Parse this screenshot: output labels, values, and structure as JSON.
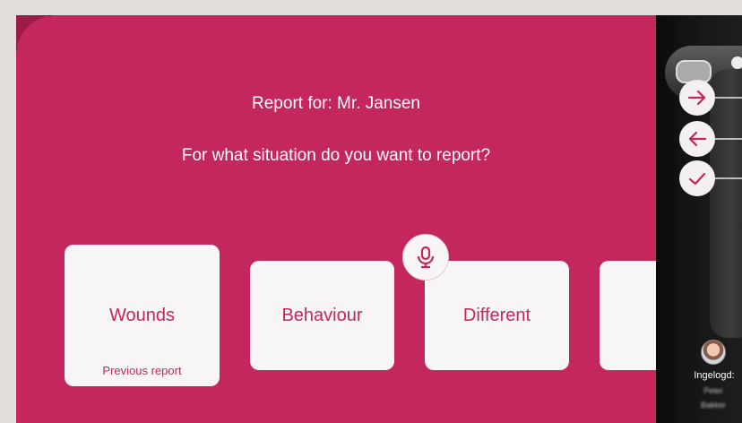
{
  "header": {
    "report_for": "Report for: Mr. Jansen",
    "question": "For what situation do you want to report?"
  },
  "options": [
    {
      "label": "Wounds",
      "sub": "Previous report"
    },
    {
      "label": "Behaviour"
    },
    {
      "label": "Different"
    }
  ],
  "mic": {
    "icon": "microphone-icon"
  },
  "device": {
    "nav_icons": [
      "arrow-right-icon",
      "arrow-left-icon",
      "check-icon"
    ],
    "login_label": "Ingelogd:",
    "user_first": "Peter",
    "user_last": "Bakker"
  },
  "colors": {
    "accent": "#c4265e",
    "card": "#f8f5f7"
  }
}
